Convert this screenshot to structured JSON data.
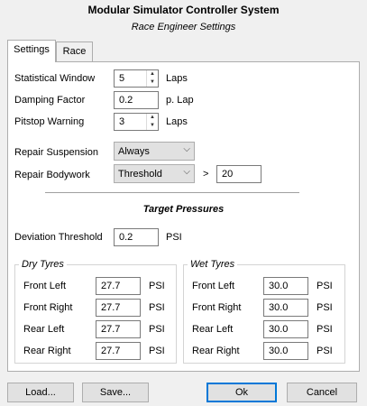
{
  "window": {
    "title": "Modular Simulator Controller System",
    "subtitle": "Race Engineer Settings"
  },
  "tabs": [
    {
      "label": "Settings",
      "active": true
    },
    {
      "label": "Race",
      "active": false
    }
  ],
  "settings": {
    "statistical_window": {
      "label": "Statistical Window",
      "value": "5",
      "unit": "Laps"
    },
    "damping_factor": {
      "label": "Damping Factor",
      "value": "0.2",
      "unit": "p. Lap"
    },
    "pitstop_warning": {
      "label": "Pitstop Warning",
      "value": "3",
      "unit": "Laps"
    },
    "repair_suspension": {
      "label": "Repair Suspension",
      "value": "Always"
    },
    "repair_bodywork": {
      "label": "Repair Bodywork",
      "value": "Threshold",
      "operator": ">",
      "threshold": "20"
    }
  },
  "target_pressures": {
    "title": "Target Pressures",
    "deviation": {
      "label": "Deviation Threshold",
      "value": "0.2",
      "unit": "PSI"
    },
    "dry": {
      "title": "Dry Tyres",
      "rows": [
        {
          "label": "Front Left",
          "value": "27.7",
          "unit": "PSI"
        },
        {
          "label": "Front Right",
          "value": "27.7",
          "unit": "PSI"
        },
        {
          "label": "Rear Left",
          "value": "27.7",
          "unit": "PSI"
        },
        {
          "label": "Rear Right",
          "value": "27.7",
          "unit": "PSI"
        }
      ]
    },
    "wet": {
      "title": "Wet Tyres",
      "rows": [
        {
          "label": "Front Left",
          "value": "30.0",
          "unit": "PSI"
        },
        {
          "label": "Front Right",
          "value": "30.0",
          "unit": "PSI"
        },
        {
          "label": "Rear Left",
          "value": "30.0",
          "unit": "PSI"
        },
        {
          "label": "Rear Right",
          "value": "30.0",
          "unit": "PSI"
        }
      ]
    }
  },
  "buttons": {
    "load": "Load...",
    "save": "Save...",
    "ok": "Ok",
    "cancel": "Cancel"
  },
  "colors": {
    "background": "#f0f0f0",
    "panel": "#ffffff",
    "default_button_border": "#0078d7"
  }
}
